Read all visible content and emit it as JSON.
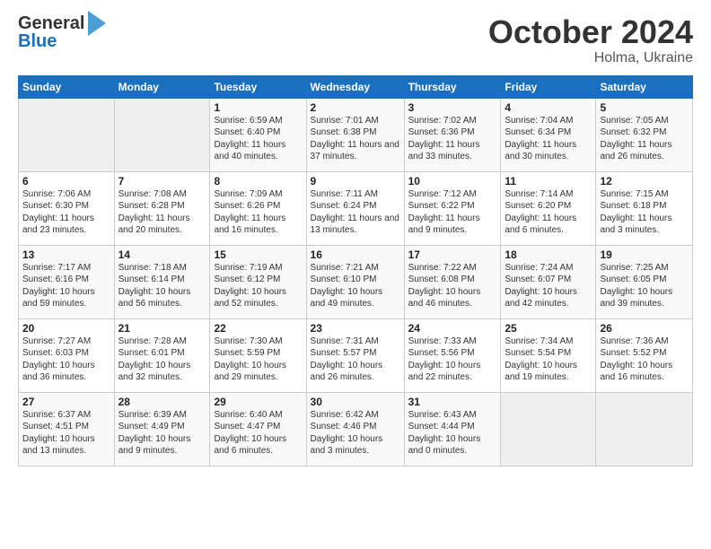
{
  "header": {
    "logo_general": "General",
    "logo_blue": "Blue",
    "month_title": "October 2024",
    "location": "Holma, Ukraine"
  },
  "calendar": {
    "days_of_week": [
      "Sunday",
      "Monday",
      "Tuesday",
      "Wednesday",
      "Thursday",
      "Friday",
      "Saturday"
    ],
    "weeks": [
      [
        {
          "day": "",
          "sunrise": "",
          "sunset": "",
          "daylight": "",
          "empty": true
        },
        {
          "day": "",
          "sunrise": "",
          "sunset": "",
          "daylight": "",
          "empty": true
        },
        {
          "day": "1",
          "sunrise": "Sunrise: 6:59 AM",
          "sunset": "Sunset: 6:40 PM",
          "daylight": "Daylight: 11 hours and 40 minutes."
        },
        {
          "day": "2",
          "sunrise": "Sunrise: 7:01 AM",
          "sunset": "Sunset: 6:38 PM",
          "daylight": "Daylight: 11 hours and 37 minutes."
        },
        {
          "day": "3",
          "sunrise": "Sunrise: 7:02 AM",
          "sunset": "Sunset: 6:36 PM",
          "daylight": "Daylight: 11 hours and 33 minutes."
        },
        {
          "day": "4",
          "sunrise": "Sunrise: 7:04 AM",
          "sunset": "Sunset: 6:34 PM",
          "daylight": "Daylight: 11 hours and 30 minutes."
        },
        {
          "day": "5",
          "sunrise": "Sunrise: 7:05 AM",
          "sunset": "Sunset: 6:32 PM",
          "daylight": "Daylight: 11 hours and 26 minutes."
        }
      ],
      [
        {
          "day": "6",
          "sunrise": "Sunrise: 7:06 AM",
          "sunset": "Sunset: 6:30 PM",
          "daylight": "Daylight: 11 hours and 23 minutes."
        },
        {
          "day": "7",
          "sunrise": "Sunrise: 7:08 AM",
          "sunset": "Sunset: 6:28 PM",
          "daylight": "Daylight: 11 hours and 20 minutes."
        },
        {
          "day": "8",
          "sunrise": "Sunrise: 7:09 AM",
          "sunset": "Sunset: 6:26 PM",
          "daylight": "Daylight: 11 hours and 16 minutes."
        },
        {
          "day": "9",
          "sunrise": "Sunrise: 7:11 AM",
          "sunset": "Sunset: 6:24 PM",
          "daylight": "Daylight: 11 hours and 13 minutes."
        },
        {
          "day": "10",
          "sunrise": "Sunrise: 7:12 AM",
          "sunset": "Sunset: 6:22 PM",
          "daylight": "Daylight: 11 hours and 9 minutes."
        },
        {
          "day": "11",
          "sunrise": "Sunrise: 7:14 AM",
          "sunset": "Sunset: 6:20 PM",
          "daylight": "Daylight: 11 hours and 6 minutes."
        },
        {
          "day": "12",
          "sunrise": "Sunrise: 7:15 AM",
          "sunset": "Sunset: 6:18 PM",
          "daylight": "Daylight: 11 hours and 3 minutes."
        }
      ],
      [
        {
          "day": "13",
          "sunrise": "Sunrise: 7:17 AM",
          "sunset": "Sunset: 6:16 PM",
          "daylight": "Daylight: 10 hours and 59 minutes."
        },
        {
          "day": "14",
          "sunrise": "Sunrise: 7:18 AM",
          "sunset": "Sunset: 6:14 PM",
          "daylight": "Daylight: 10 hours and 56 minutes."
        },
        {
          "day": "15",
          "sunrise": "Sunrise: 7:19 AM",
          "sunset": "Sunset: 6:12 PM",
          "daylight": "Daylight: 10 hours and 52 minutes."
        },
        {
          "day": "16",
          "sunrise": "Sunrise: 7:21 AM",
          "sunset": "Sunset: 6:10 PM",
          "daylight": "Daylight: 10 hours and 49 minutes."
        },
        {
          "day": "17",
          "sunrise": "Sunrise: 7:22 AM",
          "sunset": "Sunset: 6:08 PM",
          "daylight": "Daylight: 10 hours and 46 minutes."
        },
        {
          "day": "18",
          "sunrise": "Sunrise: 7:24 AM",
          "sunset": "Sunset: 6:07 PM",
          "daylight": "Daylight: 10 hours and 42 minutes."
        },
        {
          "day": "19",
          "sunrise": "Sunrise: 7:25 AM",
          "sunset": "Sunset: 6:05 PM",
          "daylight": "Daylight: 10 hours and 39 minutes."
        }
      ],
      [
        {
          "day": "20",
          "sunrise": "Sunrise: 7:27 AM",
          "sunset": "Sunset: 6:03 PM",
          "daylight": "Daylight: 10 hours and 36 minutes."
        },
        {
          "day": "21",
          "sunrise": "Sunrise: 7:28 AM",
          "sunset": "Sunset: 6:01 PM",
          "daylight": "Daylight: 10 hours and 32 minutes."
        },
        {
          "day": "22",
          "sunrise": "Sunrise: 7:30 AM",
          "sunset": "Sunset: 5:59 PM",
          "daylight": "Daylight: 10 hours and 29 minutes."
        },
        {
          "day": "23",
          "sunrise": "Sunrise: 7:31 AM",
          "sunset": "Sunset: 5:57 PM",
          "daylight": "Daylight: 10 hours and 26 minutes."
        },
        {
          "day": "24",
          "sunrise": "Sunrise: 7:33 AM",
          "sunset": "Sunset: 5:56 PM",
          "daylight": "Daylight: 10 hours and 22 minutes."
        },
        {
          "day": "25",
          "sunrise": "Sunrise: 7:34 AM",
          "sunset": "Sunset: 5:54 PM",
          "daylight": "Daylight: 10 hours and 19 minutes."
        },
        {
          "day": "26",
          "sunrise": "Sunrise: 7:36 AM",
          "sunset": "Sunset: 5:52 PM",
          "daylight": "Daylight: 10 hours and 16 minutes."
        }
      ],
      [
        {
          "day": "27",
          "sunrise": "Sunrise: 6:37 AM",
          "sunset": "Sunset: 4:51 PM",
          "daylight": "Daylight: 10 hours and 13 minutes."
        },
        {
          "day": "28",
          "sunrise": "Sunrise: 6:39 AM",
          "sunset": "Sunset: 4:49 PM",
          "daylight": "Daylight: 10 hours and 9 minutes."
        },
        {
          "day": "29",
          "sunrise": "Sunrise: 6:40 AM",
          "sunset": "Sunset: 4:47 PM",
          "daylight": "Daylight: 10 hours and 6 minutes."
        },
        {
          "day": "30",
          "sunrise": "Sunrise: 6:42 AM",
          "sunset": "Sunset: 4:46 PM",
          "daylight": "Daylight: 10 hours and 3 minutes."
        },
        {
          "day": "31",
          "sunrise": "Sunrise: 6:43 AM",
          "sunset": "Sunset: 4:44 PM",
          "daylight": "Daylight: 10 hours and 0 minutes."
        },
        {
          "day": "",
          "sunrise": "",
          "sunset": "",
          "daylight": "",
          "empty": true
        },
        {
          "day": "",
          "sunrise": "",
          "sunset": "",
          "daylight": "",
          "empty": true
        }
      ]
    ]
  }
}
